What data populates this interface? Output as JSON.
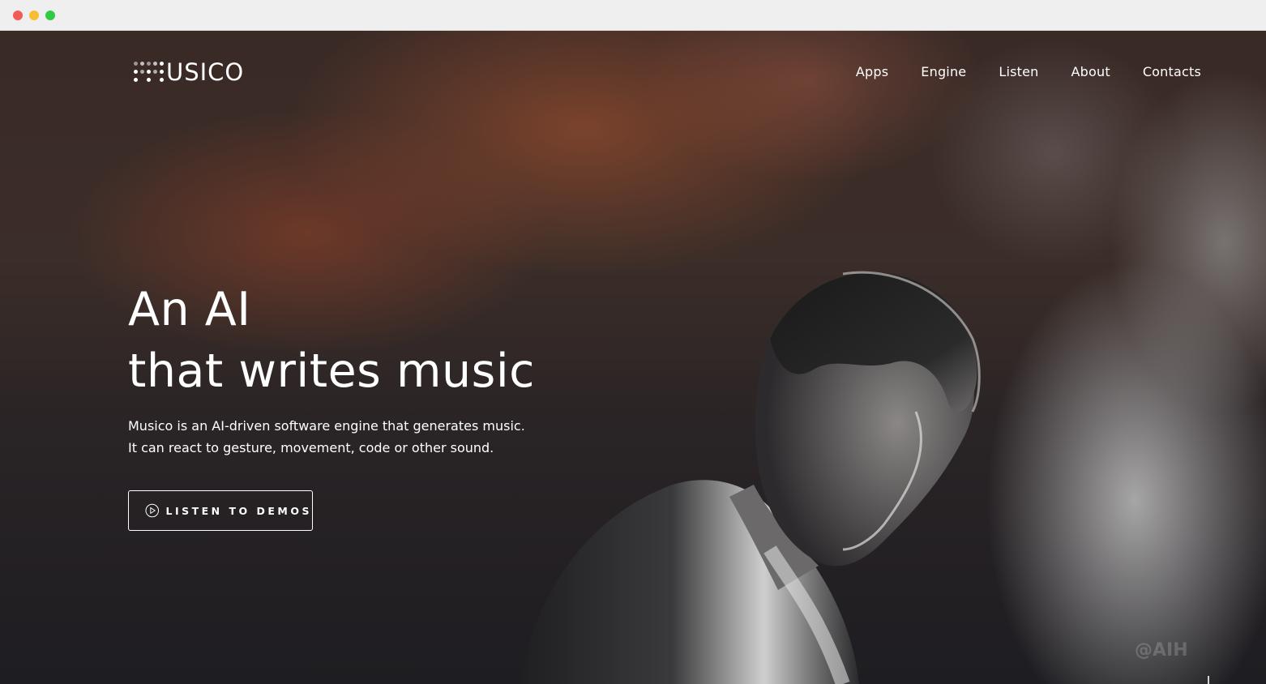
{
  "brand": {
    "logo_text": "USICO",
    "logo_icon": "dot-matrix-m-icon"
  },
  "nav": {
    "items": [
      {
        "label": "Apps"
      },
      {
        "label": "Engine"
      },
      {
        "label": "Listen"
      },
      {
        "label": "About"
      },
      {
        "label": "Contacts"
      }
    ]
  },
  "hero": {
    "headline_line1": "An AI",
    "headline_line2": "that writes music",
    "subtitle_line1": "Musico is an AI-driven software engine that generates music.",
    "subtitle_line2": "It can react to gesture, movement, code or other sound.",
    "cta_label": "LISTEN TO DEMOS",
    "cta_icon": "play-circle-icon"
  },
  "watermark": "@AIH",
  "colors": {
    "text": "#ffffff",
    "accent_smoke": "#b0563a",
    "background_dark": "#1e1d21"
  }
}
